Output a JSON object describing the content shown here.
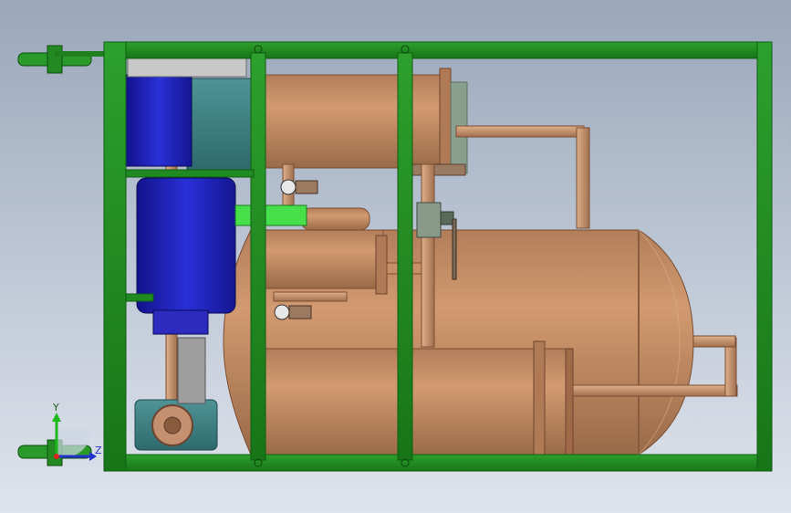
{
  "viewport": {
    "background_top": "#9aa7ba",
    "background_bottom": "#dfe4ec"
  },
  "colors": {
    "frame": "#1f8a1f",
    "frame_dark": "#0f5e12",
    "vessel": "#c98e68",
    "vessel_dark": "#8a5a3c",
    "motor": "#1e22b8",
    "pump": "#3e7f82",
    "fitting_green": "#47e04a"
  },
  "triad": {
    "y_label": "Y",
    "z_label": "Z"
  },
  "components": [
    "green-support-frame",
    "upper-vessel",
    "large-horizontal-vessel",
    "lower-vessel",
    "blue-motor-upper",
    "blue-motor-lower",
    "pump-housing",
    "pressure-gauge",
    "ball-valve",
    "copper-piping"
  ]
}
